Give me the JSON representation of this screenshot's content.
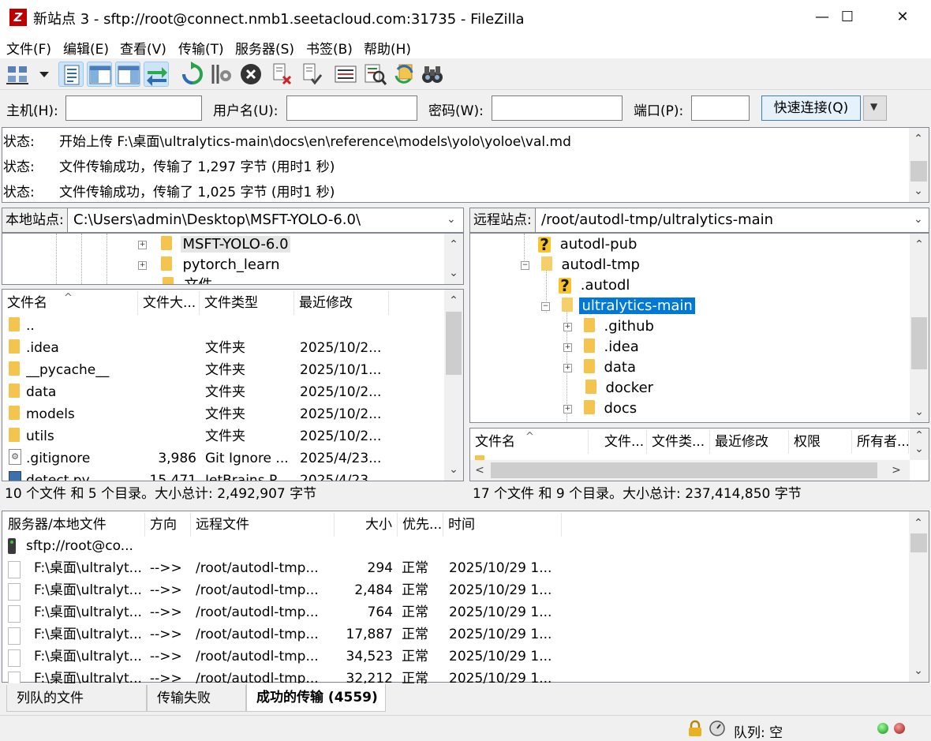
{
  "window": {
    "title": "新站点 3 - sftp://root@connect.nmb1.seetacloud.com:31735 - FileZilla",
    "app_icon": "Z",
    "minimize": "—",
    "maximize": "☐",
    "close": "✕"
  },
  "menu": [
    "文件(F)",
    "编辑(E)",
    "查看(V)",
    "传输(T)",
    "服务器(S)",
    "书签(B)",
    "帮助(H)"
  ],
  "toolbar_icons": [
    "site-manager-icon",
    "dropdown-arrow-icon",
    "toggle-message-log-icon",
    "toggle-local-tree-icon",
    "toggle-remote-tree-icon",
    "toggle-transfer-queue-icon",
    "refresh-icon",
    "process-queue-icon",
    "cancel-icon",
    "disconnect-icon",
    "reconnect-icon",
    "directory-listing-filters-icon",
    "toggle-comparison-icon",
    "sync-browsing-icon",
    "search-remote-icon"
  ],
  "quickconnect": {
    "host_label": "主机(H):",
    "host_value": "",
    "user_label": "用户名(U):",
    "user_value": "",
    "pass_label": "密码(W):",
    "pass_value": "",
    "port_label": "端口(P):",
    "port_value": "",
    "button": "快速连接(Q)",
    "dropdown": "▼"
  },
  "message_log": [
    {
      "type": "状态:",
      "text": "开始上传 F:\\桌面\\ultralytics-main\\docs\\en\\reference\\models\\yolo\\yoloe\\val.md"
    },
    {
      "type": "状态:",
      "text": "文件传输成功，传输了 1,297 字节 (用时1 秒)"
    },
    {
      "type": "状态:",
      "text": "文件传输成功，传输了 1,025 字节 (用时1 秒)"
    }
  ],
  "local": {
    "site_label": "本地站点:",
    "path": "C:\\Users\\admin\\Desktop\\MSFT-YOLO-6.0\\",
    "tree": [
      {
        "label": "MSFT-YOLO-6.0",
        "expander": "+"
      },
      {
        "label": "pytorch_learn",
        "expander": "+"
      },
      {
        "label": "文件",
        "expander": ""
      }
    ],
    "columns": [
      "文件名",
      "文件大...",
      "文件类型",
      "最近修改"
    ],
    "sort_indicator": "^",
    "files": [
      {
        "name": "..",
        "size": "",
        "type": "",
        "modified": "",
        "icon": "folder"
      },
      {
        "name": ".idea",
        "size": "",
        "type": "文件夹",
        "modified": "2025/10/2...",
        "icon": "folder"
      },
      {
        "name": "__pycache__",
        "size": "",
        "type": "文件夹",
        "modified": "2025/10/1...",
        "icon": "folder"
      },
      {
        "name": "data",
        "size": "",
        "type": "文件夹",
        "modified": "2025/10/2...",
        "icon": "folder"
      },
      {
        "name": "models",
        "size": "",
        "type": "文件夹",
        "modified": "2025/10/2...",
        "icon": "folder"
      },
      {
        "name": "utils",
        "size": "",
        "type": "文件夹",
        "modified": "2025/10/2...",
        "icon": "folder"
      },
      {
        "name": ".gitignore",
        "size": "3,986",
        "type": "Git Ignore ...",
        "modified": "2025/4/23...",
        "icon": "gear"
      },
      {
        "name": "detect.py",
        "size": "15,471",
        "type": "JetBrains P...",
        "modified": "2025/4/23...",
        "icon": "py"
      }
    ],
    "status": "10 个文件 和 5 个目录。大小总计: 2,492,907 字节"
  },
  "remote": {
    "site_label": "远程站点:",
    "path": "/root/autodl-tmp/ultralytics-main",
    "tree": [
      {
        "label": "autodl-pub",
        "kind": "unknown",
        "expander": ""
      },
      {
        "label": "autodl-tmp",
        "kind": "folder",
        "expander": "−"
      },
      {
        "label": ".autodl",
        "kind": "unknown",
        "expander": ""
      },
      {
        "label": "ultralytics-main",
        "kind": "folder-selected",
        "expander": "−"
      },
      {
        "label": ".github",
        "kind": "folder",
        "expander": "+"
      },
      {
        "label": ".idea",
        "kind": "folder",
        "expander": "+"
      },
      {
        "label": "data",
        "kind": "folder",
        "expander": "+"
      },
      {
        "label": "docker",
        "kind": "folder",
        "expander": ""
      },
      {
        "label": "docs",
        "kind": "folder",
        "expander": "+"
      }
    ],
    "columns": [
      "文件名",
      "文件...",
      "文件类...",
      "最近修改",
      "权限",
      "所有者..."
    ],
    "sort_indicator": "^",
    "status": "17 个文件 和 9 个目录。大小总计: 237,414,850 字节"
  },
  "queue": {
    "columns": [
      "服务器/本地文件",
      "方向",
      "远程文件",
      "大小",
      "优先...",
      "时间"
    ],
    "server": "sftp://root@co...",
    "rows": [
      {
        "local": "F:\\桌面\\ultralyt...",
        "dir": "-->>",
        "remote": "/root/autodl-tmp...",
        "size": "294",
        "priority": "正常",
        "time": "2025/10/29 1..."
      },
      {
        "local": "F:\\桌面\\ultralyt...",
        "dir": "-->>",
        "remote": "/root/autodl-tmp...",
        "size": "2,484",
        "priority": "正常",
        "time": "2025/10/29 1..."
      },
      {
        "local": "F:\\桌面\\ultralyt...",
        "dir": "-->>",
        "remote": "/root/autodl-tmp...",
        "size": "764",
        "priority": "正常",
        "time": "2025/10/29 1..."
      },
      {
        "local": "F:\\桌面\\ultralyt...",
        "dir": "-->>",
        "remote": "/root/autodl-tmp...",
        "size": "17,887",
        "priority": "正常",
        "time": "2025/10/29 1..."
      },
      {
        "local": "F:\\桌面\\ultralyt...",
        "dir": "-->>",
        "remote": "/root/autodl-tmp...",
        "size": "34,523",
        "priority": "正常",
        "time": "2025/10/29 1..."
      },
      {
        "local": "F:\\桌面\\ultralyt...",
        "dir": "-->>",
        "remote": "/root/autodl-tmp...",
        "size": "32,212",
        "priority": "正常",
        "time": "2025/10/29 1..."
      }
    ]
  },
  "tabs": [
    "列队的文件",
    "传输失败",
    "成功的传输 (4559)"
  ],
  "statusbar": {
    "queue": "队列: 空",
    "icons": [
      "lock-icon",
      "speed-limit-icon",
      "activity-led-green-icon",
      "activity-led-red-icon"
    ]
  },
  "colors": {
    "selection": "#0078d7",
    "folder": "#f4c44e",
    "button_accent": "#e5f1fb"
  },
  "scroll": {
    "up": "⌃",
    "down": "⌄",
    "left": "<",
    "right": ">"
  }
}
